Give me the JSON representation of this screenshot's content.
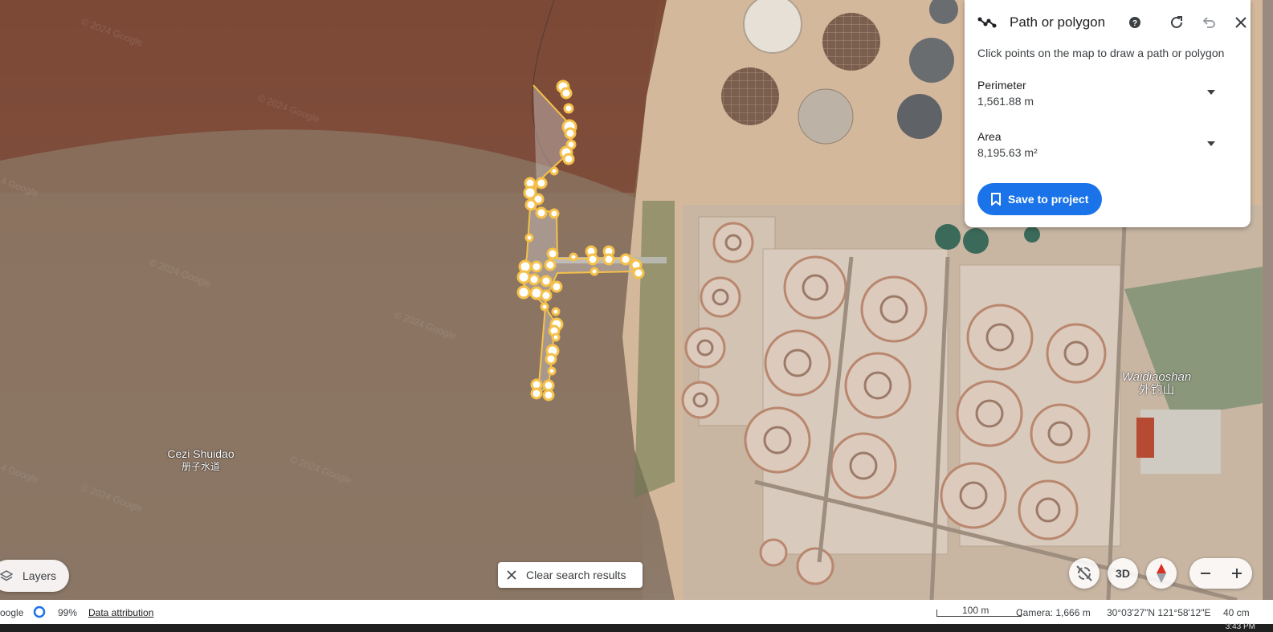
{
  "panel": {
    "title": "Path or polygon",
    "hint": "Click points on the map to draw a path or polygon",
    "perimeter_label": "Perimeter",
    "perimeter_value": "1,561.88 m",
    "area_label": "Area",
    "area_value": "8,195.63 m²",
    "save_label": "Save to project",
    "icons": [
      "path-icon",
      "help-icon",
      "refresh-icon",
      "undo-icon",
      "close-icon"
    ]
  },
  "map": {
    "labels": [
      {
        "main": "Cezi Shuidao",
        "sub": "册子水道"
      },
      {
        "main": "Waidiaoshan",
        "sub": "外钓山"
      }
    ],
    "watermark": "© 2024 Google"
  },
  "controls": {
    "layers_label": "Layers",
    "clear_search_label": "Clear search results",
    "threed_label": "3D",
    "zoom_out": "−",
    "zoom_in": "+"
  },
  "status": {
    "brand": "oogle",
    "load_percent": "99%",
    "data_attribution": "Data attribution",
    "scale": "100 m",
    "camera": "Camera: 1,666 m",
    "coordinates": "30°03'27\"N 121°58'12\"E",
    "zoom_cm": "40 cm"
  },
  "taskbar": {
    "clock": "3:43 PM"
  },
  "colors": {
    "accent": "#1a73e8",
    "path": "#f5c14a"
  }
}
